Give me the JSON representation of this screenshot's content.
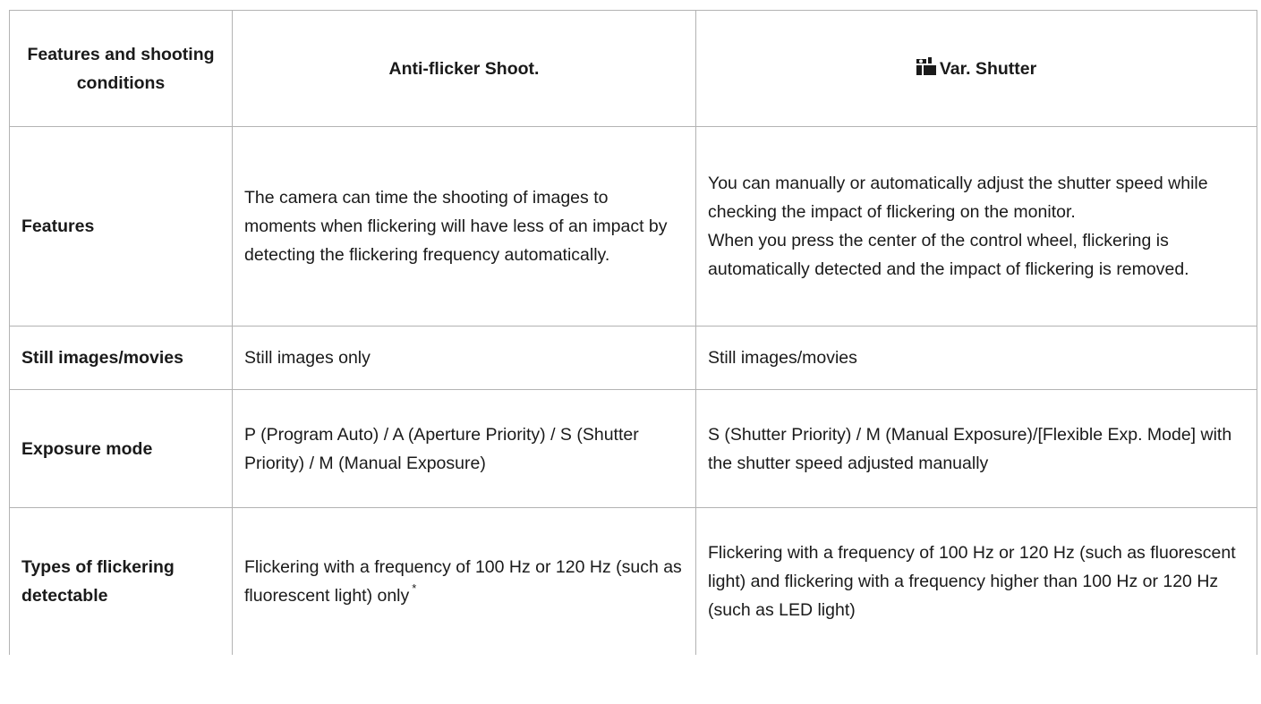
{
  "table": {
    "headers": {
      "col1": "Features and shooting conditions",
      "col2": "Anti-flicker Shoot.",
      "col3_icon": "variable-shutter-icon",
      "col3": "Var. Shutter"
    },
    "rows": [
      {
        "label": "Features",
        "anti_flicker": "The camera can time the shooting of images to moments when flickering will have less of an impact by detecting the flickering frequency automatically.",
        "var_shutter": [
          "You can manually or automatically adjust the shutter speed while checking the impact of flickering on the monitor.",
          "When you press the center of the control wheel, flickering is automatically detected and the impact of flickering is removed."
        ]
      },
      {
        "label": "Still images/movies",
        "anti_flicker": "Still images only",
        "var_shutter": "Still images/movies"
      },
      {
        "label": "Exposure mode",
        "anti_flicker": "P (Program Auto) / A (Aperture Priority) / S (Shutter Priority) / M (Manual Exposure)",
        "var_shutter": "S (Shutter Priority) / M (Manual Exposure)/[Flexible Exp. Mode] with the shutter speed adjusted manually"
      },
      {
        "label": "Types of flickering detectable",
        "anti_flicker": "Flickering with a frequency of 100 Hz or 120 Hz (such as fluorescent light) only",
        "anti_flicker_note": "*",
        "var_shutter": "Flickering with a frequency of 100 Hz or 120 Hz (such as fluorescent light) and flickering with a frequency higher than 100 Hz or 120 Hz (such as LED light)"
      }
    ]
  }
}
